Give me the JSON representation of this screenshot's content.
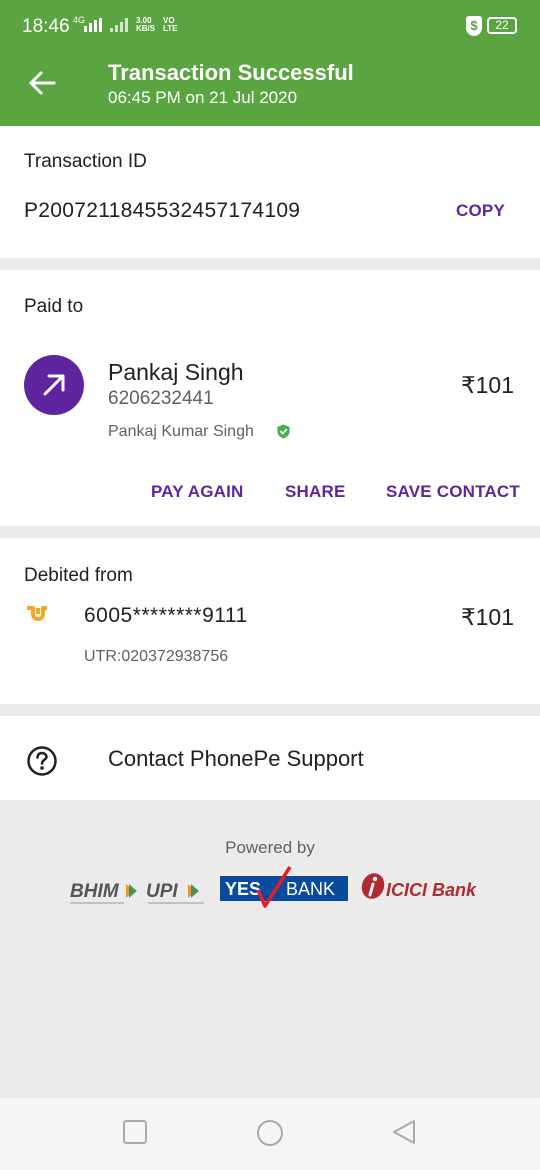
{
  "status_bar": {
    "time": "18:46",
    "network": "4G",
    "speed_value": "3.00",
    "speed_unit": "KB/S",
    "volte_top": "VO",
    "volte_bottom": "LTE",
    "shield": "$",
    "battery": "22"
  },
  "header": {
    "title": "Transaction Successful",
    "subtitle": "06:45 PM on 21 Jul 2020",
    "background_color": "#5aa541"
  },
  "transaction": {
    "label": "Transaction ID",
    "id": "P2007211845532457174109",
    "copy_label": "COPY"
  },
  "paid_to": {
    "label": "Paid to",
    "name": "Pankaj Singh",
    "phone": "6206232441",
    "full_name": "Pankaj Kumar Singh",
    "amount": "₹101",
    "actions": {
      "pay_again": "PAY AGAIN",
      "share": "SHARE",
      "save_contact": "SAVE CONTACT"
    }
  },
  "debited_from": {
    "label": "Debited from",
    "account": "6005********9111",
    "amount": "₹101",
    "utr": "UTR:020372938756"
  },
  "support": {
    "label": "Contact PhonePe Support"
  },
  "footer": {
    "powered_by": "Powered by",
    "logo_bhim": "BHIM",
    "logo_upi": "UPI",
    "logo_yes": "YES",
    "logo_bank": "BANK",
    "logo_icici": "ICICI Bank"
  },
  "colors": {
    "accent": "#5f259f",
    "success": "#4caf50"
  }
}
